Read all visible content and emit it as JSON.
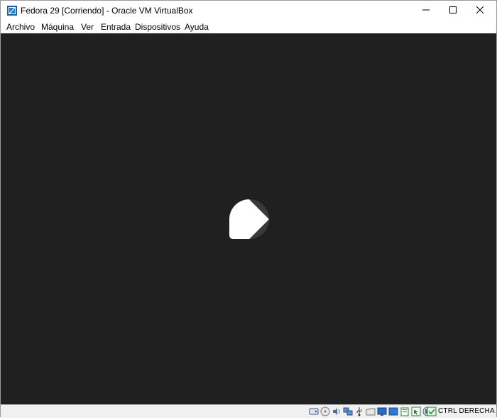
{
  "window": {
    "title": "Fedora 29 [Corriendo] - Oracle VM VirtualBox",
    "controls": {
      "minimize_icon": "minimize-icon",
      "maximize_icon": "maximize-icon",
      "close_icon": "close-icon"
    }
  },
  "menubar": {
    "items": [
      {
        "label": "Archivo"
      },
      {
        "label": "Máquina"
      },
      {
        "label": "Ver"
      },
      {
        "label": "Entrada"
      },
      {
        "label": "Dispositivos"
      },
      {
        "label": "Ayuda"
      }
    ]
  },
  "vm_screen": {
    "background_color": "#202020",
    "logo_icon": "fedora-loading-icon"
  },
  "statusbar": {
    "icons": [
      "hard-disk-icon",
      "optical-drive-icon",
      "audio-icon",
      "network-icon",
      "usb-icon",
      "shared-folders-icon",
      "display-icon",
      "video-capture-icon",
      "clipboard-icon",
      "mouse-integration-icon",
      "cpu-icon",
      "host-key-indicator-icon"
    ],
    "host_key_label": "CTRL DERECHA"
  }
}
